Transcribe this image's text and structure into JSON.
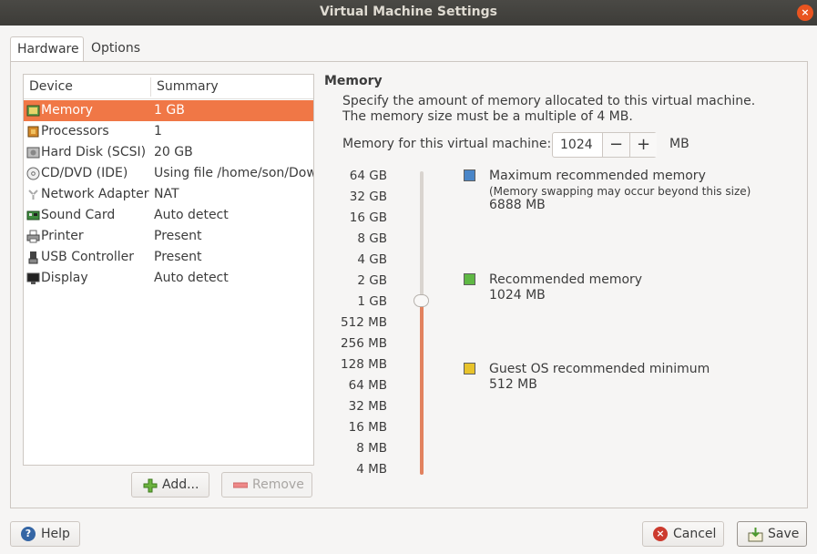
{
  "window": {
    "title": "Virtual Machine Settings",
    "close_glyph": "×"
  },
  "tabs": [
    {
      "label": "Hardware",
      "active": true
    },
    {
      "label": "Options",
      "active": false
    }
  ],
  "device_list": {
    "columns": [
      "Device",
      "Summary"
    ],
    "rows": [
      {
        "icon": "memory-chip-icon",
        "device": "Memory",
        "summary": "1 GB",
        "selected": true
      },
      {
        "icon": "processor-icon",
        "device": "Processors",
        "summary": "1",
        "selected": false
      },
      {
        "icon": "hard-disk-icon",
        "device": "Hard Disk (SCSI)",
        "summary": "20 GB",
        "selected": false
      },
      {
        "icon": "cd-dvd-icon",
        "device": "CD/DVD (IDE)",
        "summary": "Using file /home/son/Dow",
        "selected": false
      },
      {
        "icon": "network-adapter-icon",
        "device": "Network Adapter",
        "summary": "NAT",
        "selected": false
      },
      {
        "icon": "sound-card-icon",
        "device": "Sound Card",
        "summary": "Auto detect",
        "selected": false
      },
      {
        "icon": "printer-icon",
        "device": "Printer",
        "summary": "Present",
        "selected": false
      },
      {
        "icon": "usb-controller-icon",
        "device": "USB Controller",
        "summary": "Present",
        "selected": false
      },
      {
        "icon": "display-icon",
        "device": "Display",
        "summary": "Auto detect",
        "selected": false
      }
    ],
    "add_label": "Add...",
    "remove_label": "Remove"
  },
  "memory": {
    "title": "Memory",
    "description": "Specify the amount of memory allocated to this virtual machine. The memory size must be a multiple of 4 MB.",
    "field_label": "Memory for this virtual machine:",
    "value": "1024",
    "minus": "−",
    "plus": "+",
    "unit": "MB",
    "scale_labels": [
      "64 GB",
      "32 GB",
      "16 GB",
      "8 GB",
      "4 GB",
      "2 GB",
      "1 GB",
      "512 MB",
      "256 MB",
      "128 MB",
      "64 MB",
      "32 MB",
      "16 MB",
      "8 MB",
      "4 MB"
    ],
    "slider_value": "1 GB",
    "legend": [
      {
        "color": "#4a86c8",
        "label": "Maximum recommended memory",
        "note": "(Memory swapping may occur beyond this size)",
        "value": "6888 MB"
      },
      {
        "color": "#5fb844",
        "label": "Recommended memory",
        "note": "",
        "value": "1024 MB"
      },
      {
        "color": "#e8c32b",
        "label": "Guest OS recommended minimum",
        "note": "",
        "value": "512 MB"
      }
    ]
  },
  "footer": {
    "help_label": "Help",
    "cancel_label": "Cancel",
    "save_label": "Save"
  },
  "colors": {
    "accent": "#f07746",
    "selection": "#f07746"
  }
}
